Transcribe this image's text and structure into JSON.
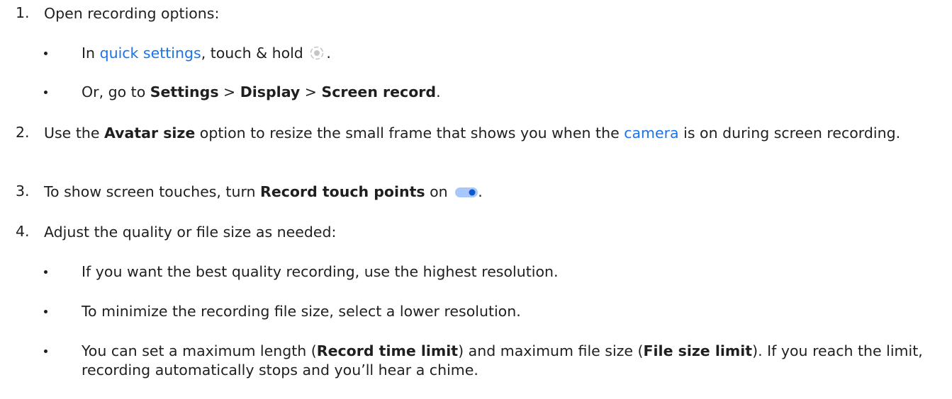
{
  "steps": [
    {
      "number": "1.",
      "text": "Open recording options:"
    },
    {
      "number": "2.",
      "pre": "Use the ",
      "bold1": "Avatar size",
      "mid": " option to resize the small frame that shows you when the ",
      "link": "camera",
      "post": " is on during screen recording."
    },
    {
      "number": "3.",
      "pre": "To show screen touches, turn ",
      "bold1": "Record touch points",
      "post": " on "
    },
    {
      "number": "4.",
      "text": "Adjust the quality or file size as needed:"
    }
  ],
  "step1_bullets": {
    "b1": {
      "pre": "In ",
      "link": "quick settings",
      "post": ", touch & hold ",
      "end": "."
    },
    "b2": {
      "pre": "Or, go to ",
      "bold1": "Settings",
      "sep1": " > ",
      "bold2": "Display",
      "sep2": " > ",
      "bold3": "Screen record",
      "end": "."
    }
  },
  "step4_bullets": {
    "b1": "If you want the best quality recording, use the highest resolution.",
    "b2": "To minimize the recording file size, select a lower resolution.",
    "b3": {
      "pre": "You can set a maximum length (",
      "bold1": "Record time limit",
      "mid": ") and maximum file size (",
      "bold2": "File size limit",
      "post": "). If you reach the limit, recording automatically stops and you’ll hear a chime."
    }
  },
  "icons": {
    "record": "screen-record-icon",
    "toggle": "toggle-on-icon"
  },
  "colors": {
    "link": "#1a73e8",
    "text": "#1f1f1f",
    "toggle_track": "#a8c7fa",
    "toggle_knob": "#0b57d0"
  }
}
